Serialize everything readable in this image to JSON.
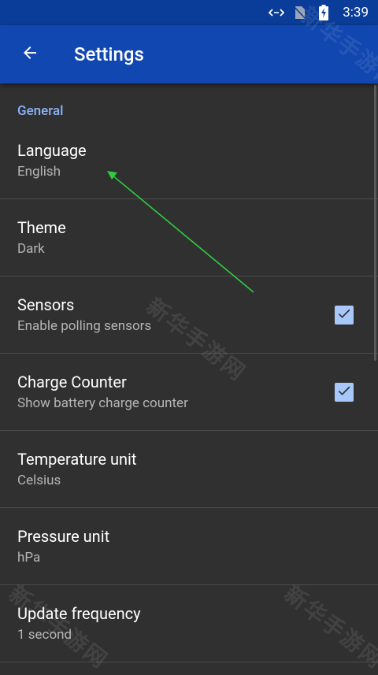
{
  "status_bar": {
    "time": "3:39",
    "icons": [
      "data-transfer-icon",
      "no-sim-icon",
      "battery-charging-icon"
    ]
  },
  "app_bar": {
    "title": "Settings",
    "back_icon": "arrow-back-icon"
  },
  "section": {
    "header": "General"
  },
  "preferences": [
    {
      "title": "Language",
      "summary": "English",
      "has_checkbox": false
    },
    {
      "title": "Theme",
      "summary": "Dark",
      "has_checkbox": false
    },
    {
      "title": "Sensors",
      "summary": "Enable polling sensors",
      "has_checkbox": true,
      "checked": true
    },
    {
      "title": "Charge Counter",
      "summary": "Show battery charge counter",
      "has_checkbox": true,
      "checked": true
    },
    {
      "title": "Temperature unit",
      "summary": "Celsius",
      "has_checkbox": false
    },
    {
      "title": "Pressure unit",
      "summary": "hPa",
      "has_checkbox": false
    },
    {
      "title": "Update frequency",
      "summary": "1 second",
      "has_checkbox": false
    }
  ],
  "watermark": "新华手游网",
  "colors": {
    "status_bar": "#0a3d99",
    "app_bar": "#1147b0",
    "background": "#303030",
    "accent": "#8ab4f8",
    "checkbox": "#a8c7fa",
    "annotation_arrow": "#2ecc40"
  }
}
